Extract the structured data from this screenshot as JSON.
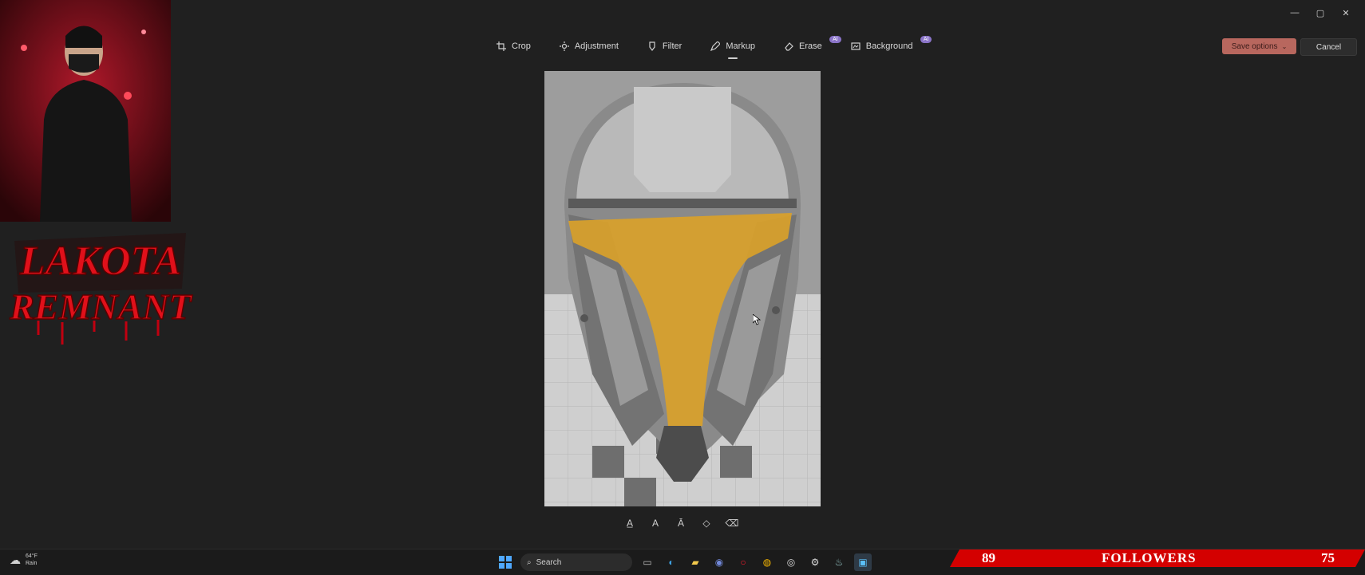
{
  "window": {
    "minimize": "—",
    "maximize": "▢",
    "close": "✕"
  },
  "toolbar": {
    "tools": [
      {
        "label": "Crop",
        "icon": "crop-icon"
      },
      {
        "label": "Adjustment",
        "icon": "adjustment-icon"
      },
      {
        "label": "Filter",
        "icon": "filter-icon"
      },
      {
        "label": "Markup",
        "icon": "markup-icon",
        "active": true
      },
      {
        "label": "Erase",
        "icon": "erase-icon",
        "badge": "AI"
      },
      {
        "label": "Background",
        "icon": "background-icon",
        "badge": "AI"
      }
    ],
    "save_label": "Save options",
    "cancel_label": "Cancel"
  },
  "markup_tools": [
    "pen-icon",
    "highlighter-icon",
    "pen-alt-icon",
    "eraser-icon",
    "clear-icon"
  ],
  "taskbar": {
    "weather_temp": "64°F",
    "weather_cond": "Rain",
    "search_placeholder": "Search"
  },
  "overlay": {
    "logo_line1": "LAKOTA",
    "logo_line2": "REMNANT",
    "followers_left": "89",
    "followers_label": "FOLLOWERS",
    "followers_right": "75"
  },
  "colors": {
    "accent_save": "#b8675e",
    "highlight_yellow": "#d9a12a",
    "followers_red": "#d40000"
  }
}
